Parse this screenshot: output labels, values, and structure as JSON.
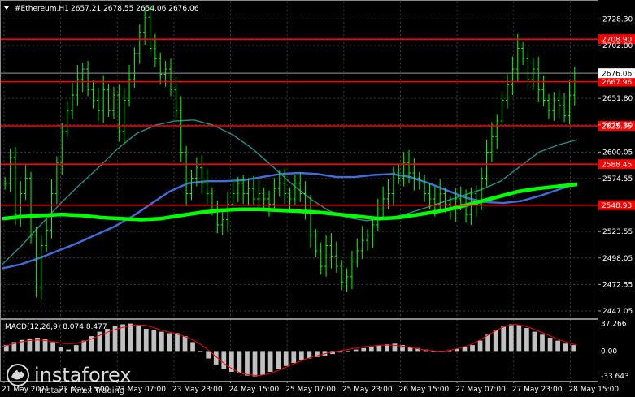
{
  "header": {
    "symbol": "#Ethereum,H1",
    "ohlc": "2657.21 2678.55 2654.06 2676.06"
  },
  "watermark": {
    "brand": "instaforex",
    "tagline": "Instant Forex Trading"
  },
  "colors": {
    "background": "#000000",
    "candle": "#00ff00",
    "ma_fast": "#00ff00",
    "ma_mid": "#3d6fe0",
    "ma_slow": "#1f8f8f",
    "level": "#ff0000",
    "macd_hist": "#c0c0c0",
    "macd_signal": "#ff0000",
    "grid": "#3a3a3a",
    "text": "#ffffff"
  },
  "chart_data": [
    {
      "type": "candlestick",
      "title": "#Ethereum,H1",
      "ylim": [
        2440,
        2745
      ],
      "price_axis_ticks": [
        2728.3,
        2702.8,
        2651.8,
        2626.3,
        2600.05,
        2574.55,
        2523.55,
        2498.05,
        2472.55,
        2447.05
      ],
      "current_price": 2676.06,
      "horizontal_levels": [
        2708.9,
        2667.96,
        2625.35,
        2588.45,
        2548.93
      ],
      "time_labels": [
        "21 May 2021",
        "22 May 15:00",
        "23 May 07:00",
        "23 May 23:00",
        "24 May 15:00",
        "25 May 07:00",
        "25 May 23:00",
        "26 May 15:00",
        "27 May 07:00",
        "27 May 23:00",
        "28 May 15:00"
      ],
      "series": [
        {
          "kind": "line",
          "role": "ma_fast",
          "values": [
            2536,
            2538,
            2539,
            2540,
            2539,
            2537,
            2536,
            2535,
            2536,
            2539,
            2542,
            2544,
            2545,
            2545,
            2544,
            2543,
            2542,
            2540,
            2538,
            2536,
            2537,
            2540,
            2543,
            2547,
            2552,
            2557,
            2562,
            2565,
            2567,
            2569
          ]
        },
        {
          "kind": "line",
          "role": "ma_mid",
          "values": [
            2488,
            2492,
            2498,
            2505,
            2512,
            2520,
            2528,
            2538,
            2550,
            2562,
            2570,
            2572,
            2572,
            2573,
            2576,
            2579,
            2580,
            2579,
            2576,
            2576,
            2578,
            2579,
            2576,
            2570,
            2563,
            2556,
            2552,
            2551,
            2553,
            2558,
            2564,
            2570
          ]
        },
        {
          "kind": "line",
          "role": "ma_slow",
          "values": [
            2492,
            2510,
            2530,
            2550,
            2568,
            2585,
            2603,
            2618,
            2626,
            2630,
            2631,
            2626,
            2617,
            2604,
            2588,
            2571,
            2556,
            2544,
            2537,
            2534,
            2536,
            2540,
            2546,
            2552,
            2558,
            2564,
            2572,
            2586,
            2600,
            2607,
            2612
          ]
        },
        {
          "kind": "candles",
          "closes": [
            2570,
            2595,
            2540,
            2560,
            2575,
            2520,
            2470,
            2510,
            2525,
            2560,
            2590,
            2620,
            2640,
            2655,
            2670,
            2680,
            2660,
            2650,
            2640,
            2660,
            2640,
            2655,
            2620,
            2650,
            2670,
            2695,
            2715,
            2730,
            2700,
            2690,
            2675,
            2680,
            2660,
            2640,
            2600,
            2560,
            2575,
            2585,
            2570,
            2560,
            2545,
            2530,
            2535,
            2550,
            2560,
            2570,
            2560,
            2565,
            2555,
            2560,
            2555,
            2550,
            2565,
            2570,
            2560,
            2555,
            2570,
            2560,
            2545,
            2520,
            2505,
            2490,
            2510,
            2500,
            2490,
            2475,
            2480,
            2495,
            2505,
            2515,
            2520,
            2530,
            2545,
            2555,
            2560,
            2580,
            2575,
            2590,
            2580,
            2575,
            2570,
            2560,
            2555,
            2550,
            2560,
            2550,
            2545,
            2555,
            2550,
            2540,
            2560,
            2550,
            2575,
            2600,
            2615,
            2630,
            2650,
            2665,
            2680,
            2700,
            2690,
            2670,
            2680,
            2660,
            2650,
            2640,
            2650,
            2645,
            2635,
            2655,
            2676
          ]
        }
      ]
    },
    {
      "type": "histogram",
      "title": "MACD(12,26,9) 8.074 8.477",
      "ylim": [
        -40,
        42
      ],
      "axis_ticks": [
        37.266,
        0.0,
        -33.643
      ],
      "histogram": [
        8,
        12,
        15,
        17,
        18,
        16,
        12,
        6,
        2,
        8,
        14,
        20,
        26,
        30,
        34,
        36,
        37,
        35,
        30,
        28,
        26,
        24,
        24,
        20,
        12,
        0,
        -10,
        -18,
        -24,
        -28,
        -30,
        -33,
        -34,
        -32,
        -28,
        -24,
        -20,
        -16,
        -12,
        -10,
        -8,
        -6,
        -4,
        -2,
        0,
        2,
        4,
        6,
        8,
        9,
        10,
        8,
        6,
        4,
        2,
        0,
        -1,
        1,
        3,
        5,
        8,
        14,
        22,
        28,
        33,
        36,
        35,
        31,
        26,
        22,
        18,
        14,
        10,
        8
      ],
      "signal": [
        6,
        9,
        12,
        14,
        15,
        14,
        12,
        10,
        10,
        12,
        16,
        21,
        26,
        30,
        33,
        35,
        35,
        32,
        28,
        25,
        22,
        18,
        12,
        4,
        -6,
        -16,
        -24,
        -30,
        -32,
        -33,
        -31,
        -27,
        -22,
        -17,
        -12,
        -8,
        -5,
        -2,
        0,
        2,
        4,
        6,
        7,
        8,
        8,
        7,
        5,
        3,
        1,
        0,
        0,
        2,
        5,
        9,
        15,
        22,
        29,
        34,
        36,
        34,
        30,
        25,
        20,
        15,
        11,
        8
      ]
    }
  ]
}
